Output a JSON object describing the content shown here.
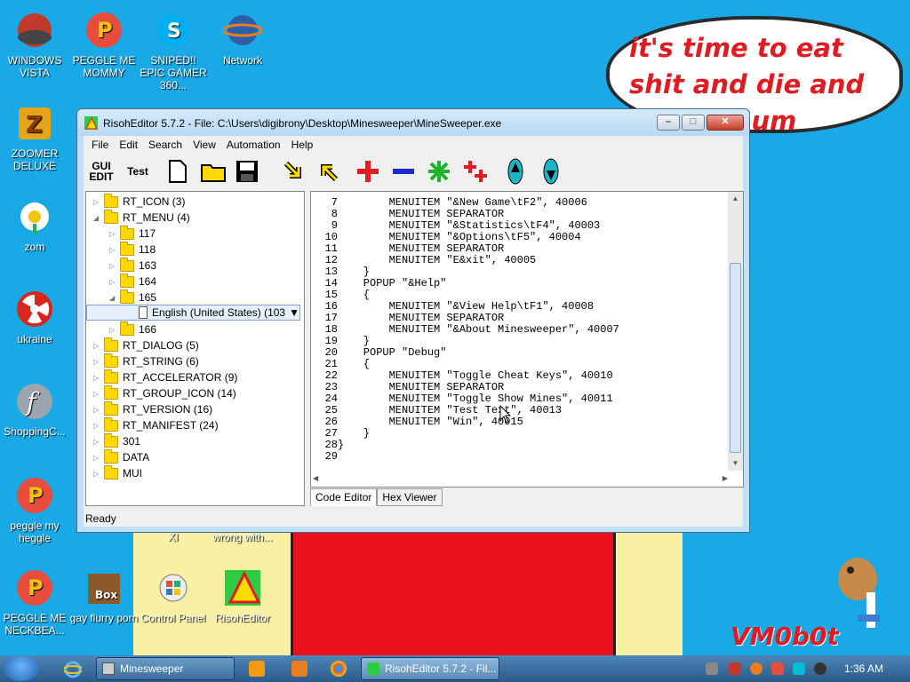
{
  "desktop": {
    "bubble_text": "it's time to eat shit and die and chew ... um",
    "watermark": "VM0b0t",
    "icons": [
      {
        "label": "WINDOWS VISTA"
      },
      {
        "label": "PEGGLE ME MOMMY"
      },
      {
        "label": "SNIPED!! EPIC GAMER 360..."
      },
      {
        "label": "Network"
      },
      {
        "label": "ZOOMER DELUXE"
      },
      {
        "label": "zom"
      },
      {
        "label": "ukraine"
      },
      {
        "label": "ShoppingC..."
      },
      {
        "label": "peggle my heggle"
      },
      {
        "label": "PEGGLE ME NECKBEA..."
      },
      {
        "label": "gay flurry porn"
      },
      {
        "label": "Control Panel"
      },
      {
        "label": "RisohEditor"
      },
      {
        "label": "XI"
      },
      {
        "label": "wrong with..."
      }
    ]
  },
  "window": {
    "title": "RisohEditor 5.7.2 - File: C:\\Users\\digibrony\\Desktop\\Minesweeper\\MineSweeper.exe",
    "menu": [
      "File",
      "Edit",
      "Search",
      "View",
      "Automation",
      "Help"
    ],
    "toolbar": {
      "gui_edit": "GUI EDIT",
      "test": "Test"
    },
    "tree": [
      {
        "label": "RT_ICON (3)",
        "level": 0,
        "expanded": false
      },
      {
        "label": "RT_MENU (4)",
        "level": 0,
        "expanded": true
      },
      {
        "label": "117",
        "level": 1,
        "expanded": false
      },
      {
        "label": "118",
        "level": 1,
        "expanded": false
      },
      {
        "label": "163",
        "level": 1,
        "expanded": false
      },
      {
        "label": "164",
        "level": 1,
        "expanded": false
      },
      {
        "label": "165",
        "level": 1,
        "expanded": true
      },
      {
        "label": "English (United States) (103",
        "level": 2,
        "selected": true
      },
      {
        "label": "166",
        "level": 1,
        "expanded": false
      },
      {
        "label": "RT_DIALOG (5)",
        "level": 0,
        "expanded": false
      },
      {
        "label": "RT_STRING (6)",
        "level": 0,
        "expanded": false
      },
      {
        "label": "RT_ACCELERATOR (9)",
        "level": 0,
        "expanded": false
      },
      {
        "label": "RT_GROUP_ICON (14)",
        "level": 0,
        "expanded": false
      },
      {
        "label": "RT_VERSION (16)",
        "level": 0,
        "expanded": false
      },
      {
        "label": "RT_MANIFEST (24)",
        "level": 0,
        "expanded": false
      },
      {
        "label": "301",
        "level": 0,
        "expanded": false
      },
      {
        "label": "DATA",
        "level": 0,
        "expanded": false
      },
      {
        "label": "MUI",
        "level": 0,
        "expanded": false
      }
    ],
    "code_lines": [
      {
        "n": "7",
        "text": "        MENUITEM \"&New Game\\tF2\", 40006"
      },
      {
        "n": "8",
        "text": "        MENUITEM SEPARATOR"
      },
      {
        "n": "9",
        "text": "        MENUITEM \"&Statistics\\tF4\", 40003"
      },
      {
        "n": "10",
        "text": "        MENUITEM \"&Options\\tF5\", 40004"
      },
      {
        "n": "11",
        "text": "        MENUITEM SEPARATOR"
      },
      {
        "n": "12",
        "text": "        MENUITEM \"E&xit\", 40005"
      },
      {
        "n": "13",
        "text": "    }"
      },
      {
        "n": "14",
        "text": "    POPUP \"&Help\""
      },
      {
        "n": "15",
        "text": "    {"
      },
      {
        "n": "16",
        "text": "        MENUITEM \"&View Help\\tF1\", 40008"
      },
      {
        "n": "17",
        "text": "        MENUITEM SEPARATOR"
      },
      {
        "n": "18",
        "text": "        MENUITEM \"&About Minesweeper\", 40007"
      },
      {
        "n": "19",
        "text": "    }"
      },
      {
        "n": "20",
        "text": "    POPUP \"Debug\""
      },
      {
        "n": "21",
        "text": "    {"
      },
      {
        "n": "22",
        "text": "        MENUITEM \"Toggle Cheat Keys\", 40010"
      },
      {
        "n": "23",
        "text": "        MENUITEM SEPARATOR"
      },
      {
        "n": "24",
        "text": "        MENUITEM \"Toggle Show Mines\", 40011"
      },
      {
        "n": "25",
        "text": "        MENUITEM \"Test Text\", 40013"
      },
      {
        "n": "26",
        "text": "        MENUITEM \"Win\", 40015"
      },
      {
        "n": "27",
        "text": "    }"
      },
      {
        "n": "28",
        "text": "}"
      },
      {
        "n": "29",
        "text": ""
      }
    ],
    "tabs": [
      "Code Editor",
      "Hex Viewer"
    ],
    "status": "Ready"
  },
  "taskbar": {
    "buttons": [
      "Minesweeper",
      "RisohEditor 5.7.2 - Fil..."
    ],
    "clock": "1:36 AM"
  }
}
